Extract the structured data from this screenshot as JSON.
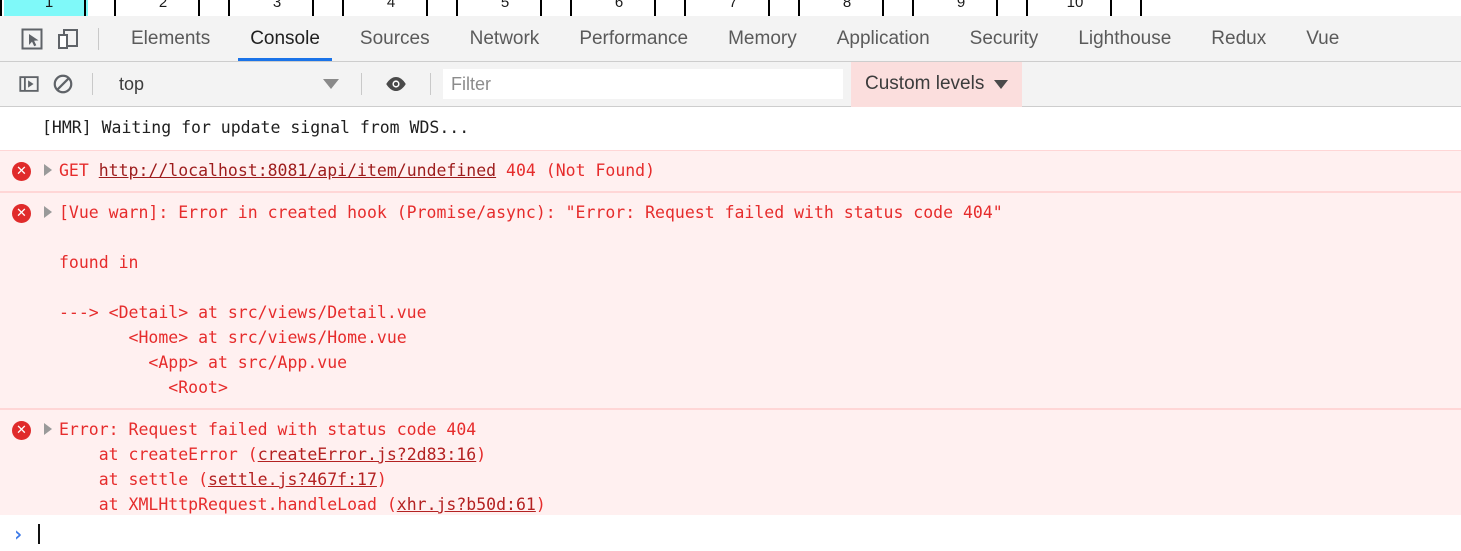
{
  "ruler": {
    "name": "page-ruler",
    "marks": [
      "1",
      "2",
      "3",
      "4",
      "5",
      "6",
      "7",
      "8",
      "9",
      "10"
    ],
    "highlighted": "1",
    "highlight_color": "#7ff9f9"
  },
  "tabbar": {
    "icons": [
      {
        "name": "inspect-element-icon",
        "title": "Inspect element"
      },
      {
        "name": "device-toolbar-icon",
        "title": "Toggle device toolbar"
      }
    ],
    "tabs": [
      {
        "label": "Elements",
        "active": false
      },
      {
        "label": "Console",
        "active": true
      },
      {
        "label": "Sources",
        "active": false
      },
      {
        "label": "Network",
        "active": false
      },
      {
        "label": "Performance",
        "active": false
      },
      {
        "label": "Memory",
        "active": false
      },
      {
        "label": "Application",
        "active": false
      },
      {
        "label": "Security",
        "active": false
      },
      {
        "label": "Lighthouse",
        "active": false
      },
      {
        "label": "Redux",
        "active": false
      },
      {
        "label": "Vue",
        "active": false
      }
    ],
    "active_tab": "Console",
    "active_underline_color": "#1a73e8"
  },
  "filterbar": {
    "sidebar_toggle": "show-console-sidebar-icon",
    "clear_console": "clear-console-icon",
    "context": "top",
    "eye": "live-expression-eye-icon",
    "filter": {
      "value": "",
      "placeholder": "Filter"
    },
    "levels": {
      "label": "Custom levels",
      "background": "#fbdedd"
    }
  },
  "console": {
    "messages": [
      {
        "type": "info",
        "icon": null,
        "expandable": false,
        "lines": [
          {
            "segments": [
              {
                "text": "[HMR] Waiting for update signal from WDS...",
                "style": "info"
              }
            ]
          }
        ]
      },
      {
        "type": "error",
        "icon": "error-circle-icon",
        "expandable": true,
        "lines": [
          {
            "segments": [
              {
                "text": "GET ",
                "style": "plain"
              },
              {
                "text": "http://localhost:8081/api/item/undefined",
                "style": "link-url"
              },
              {
                "text": " 404 (Not Found)",
                "style": "plain"
              }
            ]
          }
        ]
      },
      {
        "type": "error",
        "icon": "error-circle-icon",
        "expandable": true,
        "lines": [
          {
            "segments": [
              {
                "text": "[Vue warn]: Error in created hook (Promise/async): \"Error: Request failed with status code 404\"",
                "style": "plain"
              }
            ]
          },
          {
            "segments": [
              {
                "text": "",
                "style": "plain"
              }
            ]
          },
          {
            "segments": [
              {
                "text": "found in",
                "style": "plain"
              }
            ]
          },
          {
            "segments": [
              {
                "text": "",
                "style": "plain"
              }
            ]
          },
          {
            "segments": [
              {
                "text": "---> <Detail> at src/views/Detail.vue",
                "style": "plain"
              }
            ]
          },
          {
            "segments": [
              {
                "text": "       <Home> at src/views/Home.vue",
                "style": "plain"
              }
            ]
          },
          {
            "segments": [
              {
                "text": "         <App> at src/App.vue",
                "style": "plain"
              }
            ]
          },
          {
            "segments": [
              {
                "text": "           <Root>",
                "style": "plain"
              }
            ]
          }
        ]
      },
      {
        "type": "error",
        "icon": "error-circle-icon",
        "expandable": true,
        "lines": [
          {
            "segments": [
              {
                "text": "Error: Request failed with status code 404",
                "style": "plain"
              }
            ]
          },
          {
            "segments": [
              {
                "text": "    at createError (",
                "style": "plain"
              },
              {
                "text": "createError.js?2d83:16",
                "style": "link"
              },
              {
                "text": ")",
                "style": "plain"
              }
            ]
          },
          {
            "segments": [
              {
                "text": "    at settle (",
                "style": "plain"
              },
              {
                "text": "settle.js?467f:17",
                "style": "link"
              },
              {
                "text": ")",
                "style": "plain"
              }
            ]
          },
          {
            "segments": [
              {
                "text": "    at XMLHttpRequest.handleLoad (",
                "style": "plain"
              },
              {
                "text": "xhr.js?b50d:61",
                "style": "link"
              },
              {
                "text": ")",
                "style": "plain"
              }
            ]
          }
        ]
      }
    ]
  },
  "prompt": {
    "arrow": "›",
    "value": "",
    "arrow_color": "#3b78e7"
  }
}
